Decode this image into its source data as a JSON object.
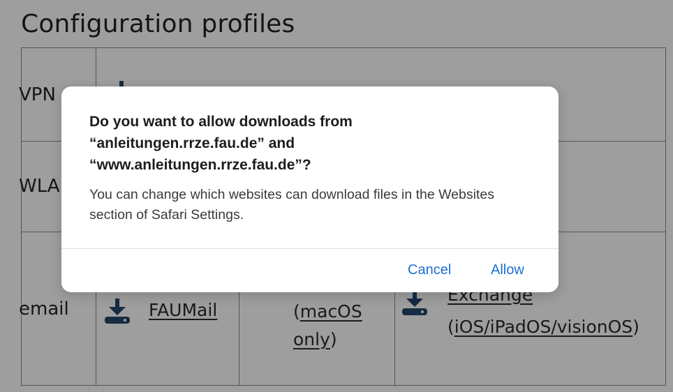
{
  "page": {
    "heading": "Configuration profiles"
  },
  "table": {
    "rows": [
      {
        "label": "VPN"
      },
      {
        "label": "WLAN"
      },
      {
        "label": "email",
        "links": [
          {
            "text": "FAUMail"
          },
          {
            "line1": "(",
            "line1_link": "macOS",
            "line2_link": "only",
            "line2_tail": ")"
          },
          {
            "line1_link": "Exchange",
            "line2_open": "(",
            "line2_link": "iOS/iPadOS/visionOS",
            "line2_close": ")"
          }
        ]
      }
    ]
  },
  "dialog": {
    "title": "Do you want to allow downloads from\n“anleitungen.rrze.fau.de” and\n“www.anleitungen.rrze.fau.de”?",
    "message": "You can change which websites can download files in the Websites section of Safari Settings.",
    "cancel_label": "Cancel",
    "allow_label": "Allow"
  },
  "colors": {
    "accent": "#1f6fd1",
    "icon": "#24476b",
    "dim_overlay": "rgba(0,0,0,0.38)"
  },
  "icons": [
    "download-icon"
  ]
}
